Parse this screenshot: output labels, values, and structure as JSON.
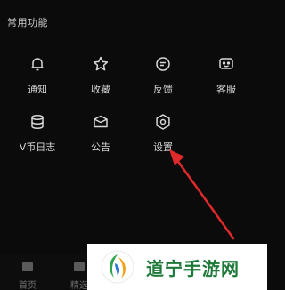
{
  "section": {
    "title": "常用功能"
  },
  "items": [
    {
      "label": "通知",
      "icon": "bell-icon"
    },
    {
      "label": "收藏",
      "icon": "star-icon"
    },
    {
      "label": "反馈",
      "icon": "feedback-icon"
    },
    {
      "label": "客服",
      "icon": "service-icon"
    },
    {
      "label": "V币日志",
      "icon": "coins-icon"
    },
    {
      "label": "公告",
      "icon": "announcement-icon"
    },
    {
      "label": "设置",
      "icon": "gear-icon"
    }
  ],
  "bottom_tabs": [
    {
      "label": "首页",
      "icon": "home-icon"
    },
    {
      "label": "精选",
      "icon": "featured-icon"
    }
  ],
  "watermark": {
    "text": "道宁手游网"
  },
  "colors": {
    "background": "#0b0b0b",
    "text": "#d4d4d4",
    "arrow": "#e0292b",
    "watermark_green": "#1f7a3a"
  }
}
